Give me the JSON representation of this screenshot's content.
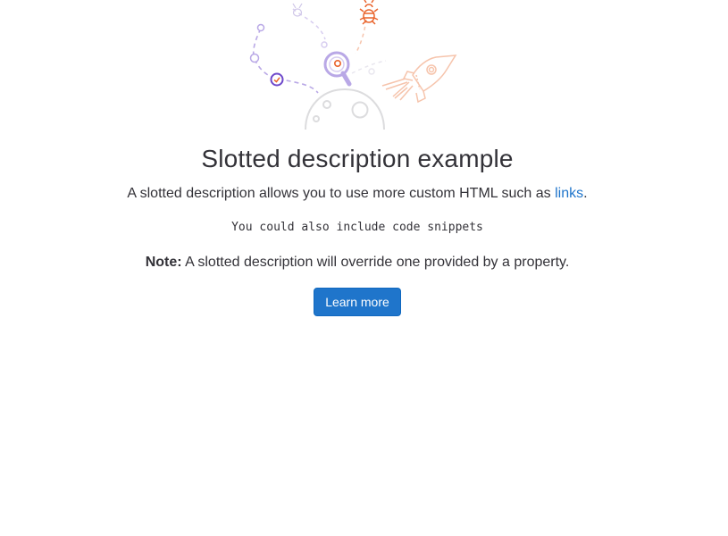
{
  "empty_state": {
    "title": "Slotted description example",
    "description_prefix": "A slotted description allows you to use more custom HTML such as ",
    "description_link": "links",
    "description_suffix": ".",
    "code_snippet": "You could also include code snippets",
    "note_label": "Note:",
    "note_text": " A slotted description will override one provided by a property.",
    "button_label": "Learn more"
  },
  "colors": {
    "link": "#1f75cb",
    "button_bg": "#1f75cb",
    "illustration_purple": "#6e49cb",
    "illustration_orange": "#e9632b"
  },
  "icons": [
    "search-magnifier-illustration",
    "bug-illustration",
    "rocket-illustration",
    "planet-illustration",
    "checkmark-illustration"
  ]
}
